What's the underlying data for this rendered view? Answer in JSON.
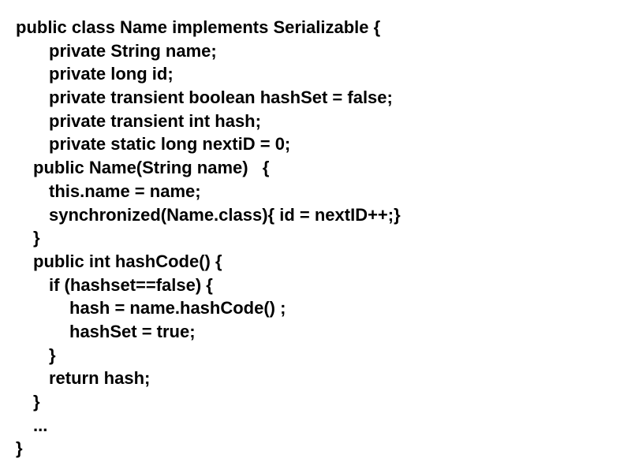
{
  "code": {
    "line1": "public class Name implements Serializable {",
    "line2": "private String name;",
    "line3": "private long id;",
    "line4": "private transient boolean hashSet = false;",
    "line5": "private transient int hash;",
    "line6": "private static long nextiD = 0;",
    "line7": "public Name(String name)   {",
    "line8": "this.name = name;",
    "line9": "synchronized(Name.class){ id = nextID++;}",
    "line10": "}",
    "line11": "public int hashCode() {",
    "line12": "if (hashset==false) {",
    "line13": "hash = name.hashCode() ;",
    "line14": "hashSet = true;",
    "line15": "}",
    "line16": "return hash;",
    "line17": "}",
    "line18": "...",
    "line19": "}"
  }
}
